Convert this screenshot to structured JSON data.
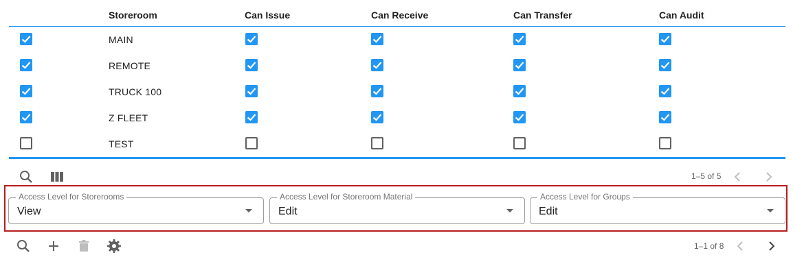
{
  "table": {
    "headers": {
      "storeroom": "Storeroom",
      "can_issue": "Can Issue",
      "can_receive": "Can Receive",
      "can_transfer": "Can Transfer",
      "can_audit": "Can Audit"
    },
    "rows": [
      {
        "name": "MAIN",
        "selected": true,
        "issue": true,
        "receive": true,
        "transfer": true,
        "audit": true
      },
      {
        "name": "REMOTE",
        "selected": true,
        "issue": true,
        "receive": true,
        "transfer": true,
        "audit": true
      },
      {
        "name": "TRUCK 100",
        "selected": true,
        "issue": true,
        "receive": true,
        "transfer": true,
        "audit": true
      },
      {
        "name": "Z FLEET",
        "selected": true,
        "issue": true,
        "receive": true,
        "transfer": true,
        "audit": true
      },
      {
        "name": "TEST",
        "selected": false,
        "issue": false,
        "receive": false,
        "transfer": false,
        "audit": false
      }
    ],
    "pager": "1–5 of 5"
  },
  "fields": {
    "storerooms": {
      "label": "Access Level for Storerooms",
      "value": "View"
    },
    "material": {
      "label": "Access Level for Storeroom Material",
      "value": "Edit"
    },
    "groups": {
      "label": "Access Level for Groups",
      "value": "Edit"
    }
  },
  "bottom_toolbar": {
    "pager": "1–1 of 8"
  },
  "colors": {
    "accent": "#2196f3",
    "highlight_border": "#b71c1c"
  },
  "icons": {
    "search": "search-icon",
    "columns": "columns-icon",
    "add": "plus-icon",
    "delete": "trash-icon",
    "settings": "gear-icon",
    "prev": "chevron-left-icon",
    "next": "chevron-right-icon"
  }
}
